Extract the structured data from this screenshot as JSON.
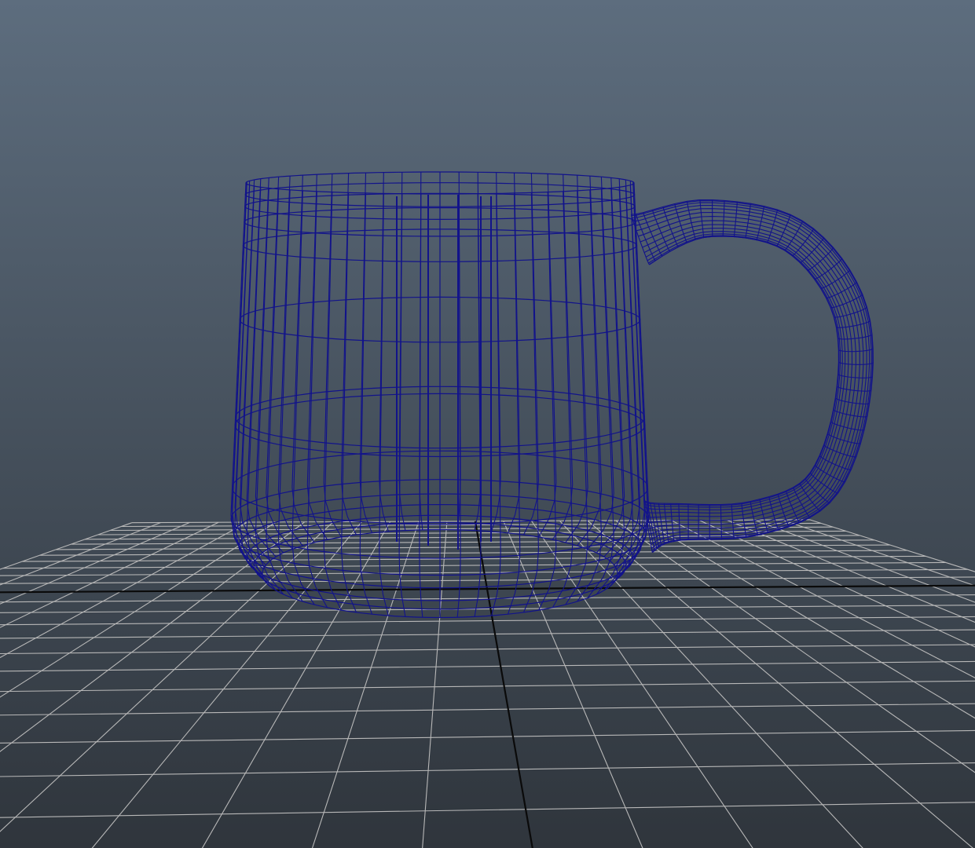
{
  "viewport": {
    "background_top": "#5d6d7e",
    "background_bottom": "#2f353c",
    "grid_color": "#b8b8b8",
    "axis_color": "#0a0a0a",
    "wireframe_color": "#12138a",
    "display_mode": "wireframe"
  },
  "scene_objects": [
    {
      "name": "mug",
      "icon": "mug-wireframe"
    }
  ]
}
